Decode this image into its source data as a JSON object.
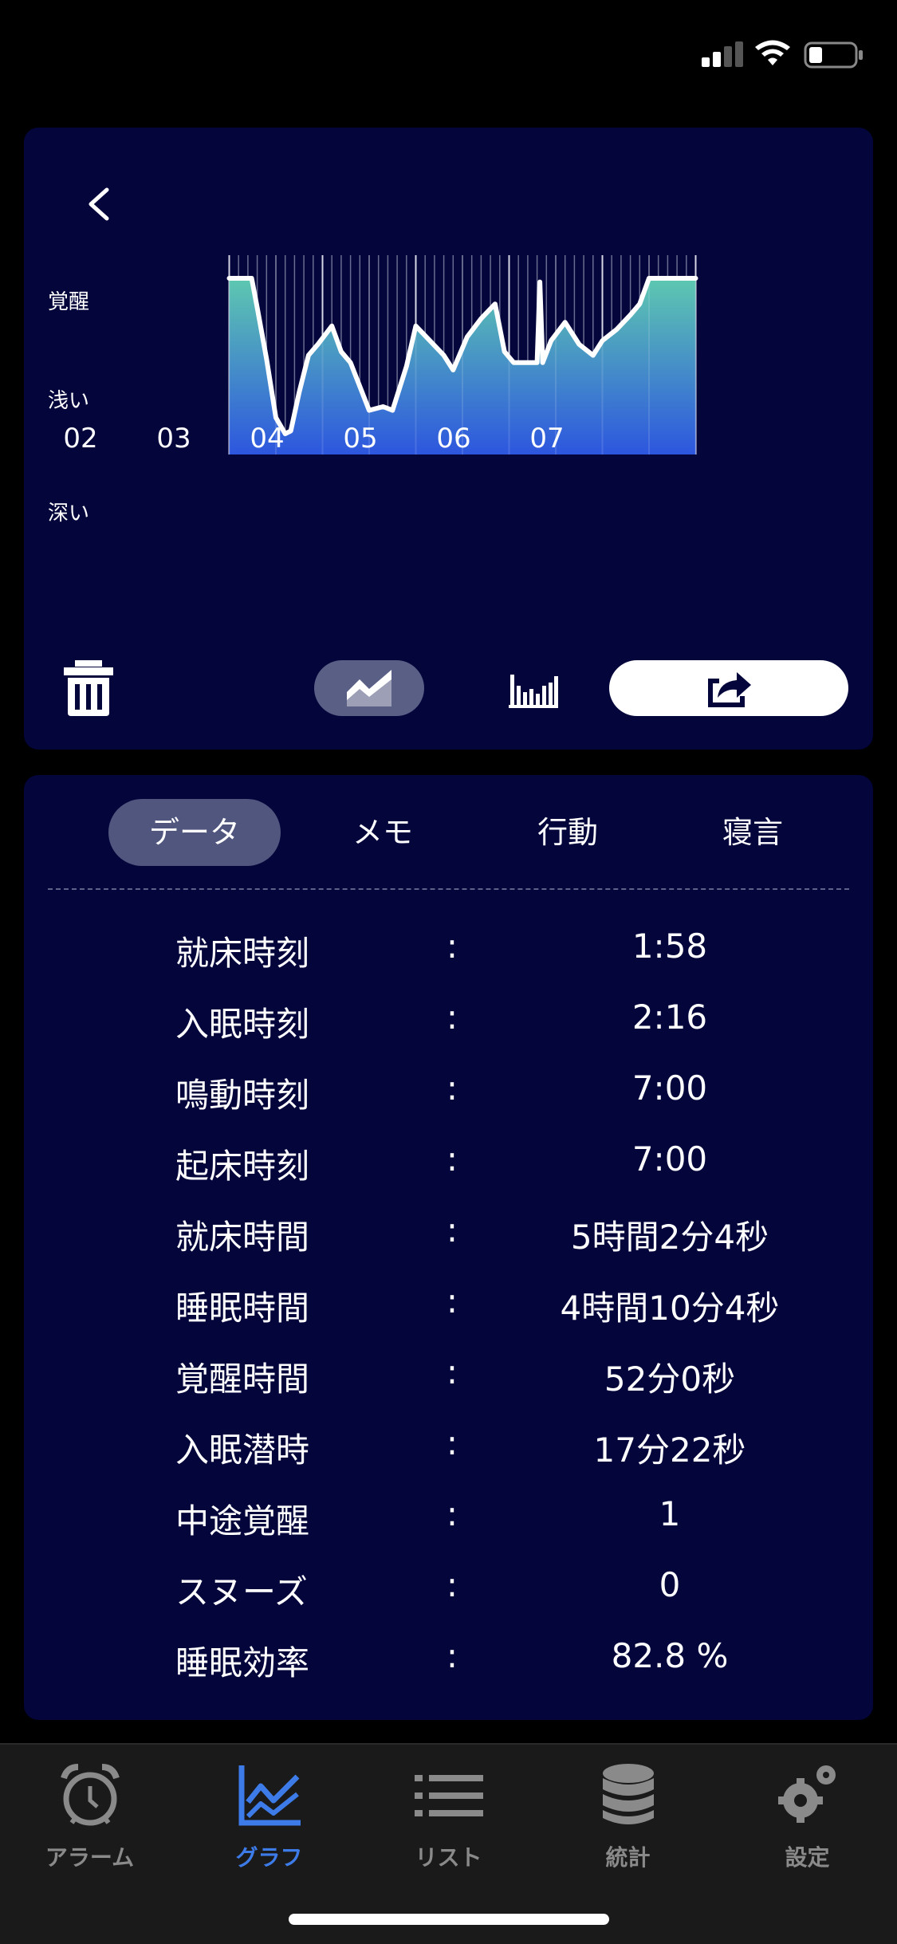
{
  "colors": {
    "card_bg": "#03053b",
    "tab_bar_bg": "#1a1a1a",
    "accent_blue": "#3d7be8",
    "chart_top": "#5ec8b0",
    "chart_bottom": "#2d56df"
  },
  "chart_data": {
    "type": "area",
    "y_categories": [
      "覚醒",
      "浅い",
      "深い"
    ],
    "x_ticks": [
      "02",
      "03",
      "04",
      "05",
      "06",
      "07"
    ],
    "x_range": [
      2.0,
      7.0
    ],
    "y_scale": "0 = 深い, 1 = 浅い, 2 = 覚醒",
    "points": [
      [
        2.0,
        2.0
      ],
      [
        2.24,
        2.0
      ],
      [
        2.3,
        1.6
      ],
      [
        2.4,
        0.9
      ],
      [
        2.5,
        0.1
      ],
      [
        2.6,
        -0.12
      ],
      [
        2.66,
        -0.08
      ],
      [
        2.75,
        0.45
      ],
      [
        2.85,
        0.95
      ],
      [
        2.95,
        1.1
      ],
      [
        3.1,
        1.35
      ],
      [
        3.2,
        1.0
      ],
      [
        3.3,
        0.85
      ],
      [
        3.5,
        0.2
      ],
      [
        3.65,
        0.25
      ],
      [
        3.75,
        0.2
      ],
      [
        3.9,
        0.8
      ],
      [
        4.0,
        1.35
      ],
      [
        4.15,
        1.15
      ],
      [
        4.3,
        0.95
      ],
      [
        4.4,
        0.75
      ],
      [
        4.55,
        1.2
      ],
      [
        4.7,
        1.45
      ],
      [
        4.85,
        1.65
      ],
      [
        4.95,
        1.0
      ],
      [
        5.05,
        0.85
      ],
      [
        5.2,
        0.85
      ],
      [
        5.3,
        0.85
      ],
      [
        5.33,
        1.95
      ],
      [
        5.36,
        0.85
      ],
      [
        5.45,
        1.15
      ],
      [
        5.6,
        1.4
      ],
      [
        5.75,
        1.1
      ],
      [
        5.9,
        0.95
      ],
      [
        6.0,
        1.15
      ],
      [
        6.15,
        1.3
      ],
      [
        6.3,
        1.5
      ],
      [
        6.4,
        1.65
      ],
      [
        6.5,
        2.0
      ],
      [
        7.0,
        2.0
      ]
    ]
  },
  "tabs": [
    {
      "label": "データ",
      "active": true
    },
    {
      "label": "メモ",
      "active": false
    },
    {
      "label": "行動",
      "active": false
    },
    {
      "label": "寝言",
      "active": false
    }
  ],
  "stats": [
    {
      "label": "就床時刻",
      "sep": ":",
      "value": "1:58"
    },
    {
      "label": "入眠時刻",
      "sep": ":",
      "value": "2:16"
    },
    {
      "label": "鳴動時刻",
      "sep": ":",
      "value": "7:00"
    },
    {
      "label": "起床時刻",
      "sep": ":",
      "value": "7:00"
    },
    {
      "label": "就床時間",
      "sep": ":",
      "value": "5時間2分4秒"
    },
    {
      "label": "睡眠時間",
      "sep": ":",
      "value": "4時間10分4秒"
    },
    {
      "label": "覚醒時間",
      "sep": ":",
      "value": "52分0秒"
    },
    {
      "label": "入眠潜時",
      "sep": ":",
      "value": "17分22秒"
    },
    {
      "label": "中途覚醒",
      "sep": ":",
      "value": "1"
    },
    {
      "label": "スヌーズ",
      "sep": ":",
      "value": "0"
    },
    {
      "label": "睡眠効率",
      "sep": ":",
      "value": "82.8 %"
    }
  ],
  "toolbar": {
    "trash_icon": "trash-icon",
    "line_view_icon": "line-chart-icon",
    "bar_view_icon": "bar-chart-icon",
    "share_icon": "share-icon"
  },
  "tab_bar": [
    {
      "label": "アラーム",
      "icon": "alarm-clock-icon",
      "active": false
    },
    {
      "label": "グラフ",
      "icon": "graph-icon",
      "active": true
    },
    {
      "label": "リスト",
      "icon": "list-icon",
      "active": false
    },
    {
      "label": "統計",
      "icon": "database-icon",
      "active": false
    },
    {
      "label": "設定",
      "icon": "settings-icon",
      "active": false
    }
  ]
}
